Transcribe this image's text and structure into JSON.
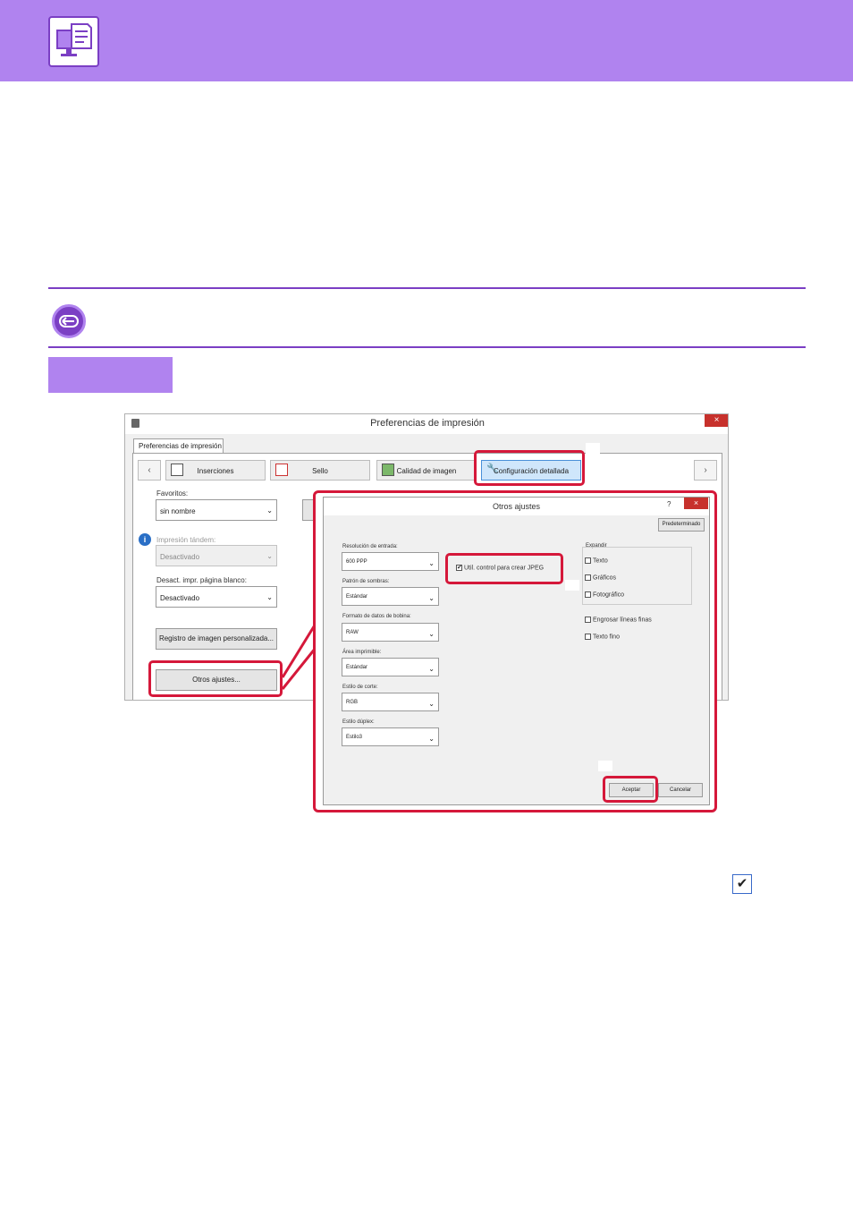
{
  "main_dialog": {
    "title": "Preferencias de impresión",
    "close": "×",
    "tab_label": "Preferencias de impresión",
    "nav_prev": "‹",
    "nav_next": "›",
    "toolbar": [
      "Inserciones",
      "Sello",
      "Calidad de imagen",
      "Configuración detallada"
    ],
    "favoritos_label": "Favoritos:",
    "favoritos_value": "sin nombre",
    "tandem_label": "Impresión tándem:",
    "tandem_value": "Desactivado",
    "blank_label": "Desact. impr. página blanco:",
    "blank_value": "Desactivado",
    "registro_button": "Registro de imagen personalizada...",
    "otros_button": "Otros ajustes..."
  },
  "sub_dialog": {
    "title": "Otros ajustes",
    "help": "?",
    "close": "×",
    "default_button": "Predeterminado",
    "fields": [
      {
        "label": "Resolución de entrada:",
        "value": "600 PPP"
      },
      {
        "label": "Patrón de sombras:",
        "value": "Estándar"
      },
      {
        "label": "Formato de datos de bobina:",
        "value": "RAW"
      },
      {
        "label": "Área imprimible:",
        "value": "Estándar"
      },
      {
        "label": "Estilo de corte:",
        "value": "RGB"
      },
      {
        "label": "Estilo dúplex:",
        "value": "Estilo3"
      }
    ],
    "jpeg_checkbox": "Util. control para crear JPEG",
    "jpeg_checked": "✔",
    "expand_label": "Expandir",
    "expand_options": [
      "Texto",
      "Gráficos",
      "Fotográfico"
    ],
    "extra_options": [
      "Engrosar líneas finas",
      "Texto fino"
    ],
    "ok_button": "Aceptar",
    "cancel_button": "Cancelar"
  },
  "checkmark_glyph": "✔",
  "colors": {
    "accent": "#b083ef",
    "accent_dark": "#7b3fc4",
    "highlight": "#d5183a"
  }
}
